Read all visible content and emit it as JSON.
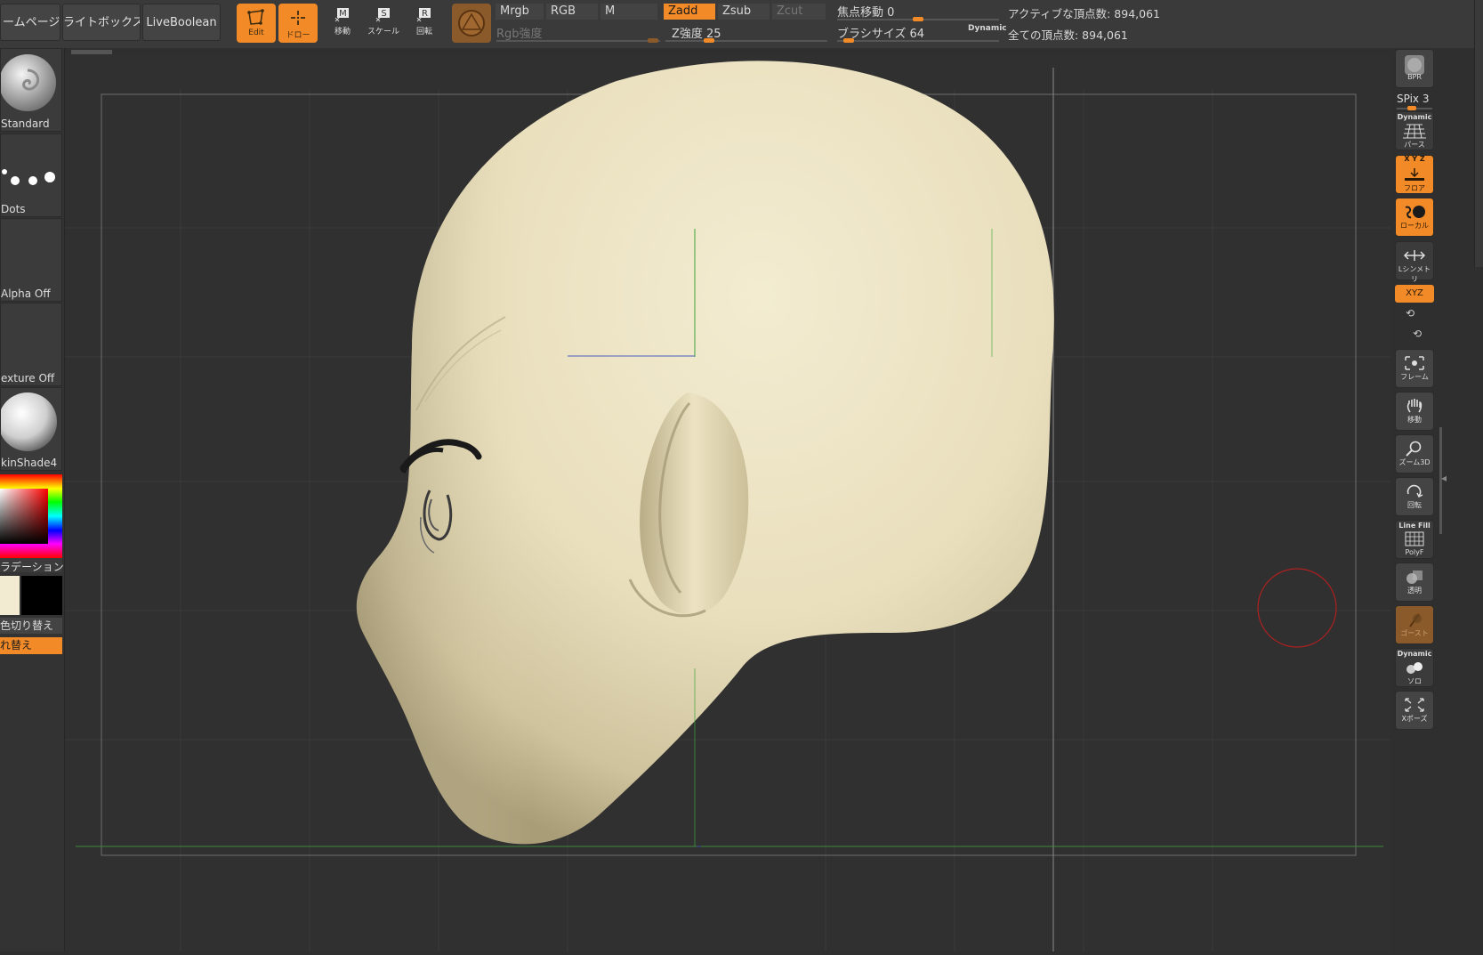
{
  "topbar": {
    "home_page": "ームページ",
    "lightbox": "ライトボックス",
    "liveboolean": "LiveBoolean",
    "edit_label": "Edit",
    "draw_label": "ドロー",
    "move_label": "移動",
    "scale_label": "スケール",
    "rotate_label": "回転",
    "mrgb": "Mrgb",
    "rgb": "RGB",
    "m": "M",
    "rgb_intensity": "Rgb強度",
    "zadd": "Zadd",
    "zsub": "Zsub",
    "zcut": "Zcut",
    "z_intensity_label": "Z強度 25",
    "z_intensity_value": 25,
    "focal_shift_label": "焦点移動 0",
    "focal_shift_value": 0,
    "draw_size_label": "ブラシサイズ 64",
    "draw_size_value": 64,
    "dynamic": "Dynamic",
    "active_points": "アクティブな頂点数: 894,061",
    "total_points": "全ての頂点数: 894,061"
  },
  "leftpanel": {
    "brush": "Standard",
    "stroke": "Dots",
    "alpha": "Alpha Off",
    "texture": "exture Off",
    "material": "kinShade4",
    "gradient": "ラデーション",
    "switch_color": "色切り替え",
    "alternate": "れ替え"
  },
  "rightshelf": {
    "bpr": "BPR",
    "spix": "SPix 3",
    "dynamic_top": "Dynamic",
    "persp": "パース",
    "xyz_top": "X Y Z",
    "floor": "フロア",
    "local": "ローカル",
    "lsym": "Lシンメトリ",
    "xyz_rot": "XYZ",
    "frame": "フレーム",
    "move": "移動",
    "zoom3d": "ズーム3D",
    "rotate": "回転",
    "linefill": "Line Fill",
    "polyf": "PolyF",
    "transp": "透明",
    "ghost": "ゴースト",
    "dynamic_top2": "Dynamic",
    "solo": "ソロ",
    "xpose": "Xポーズ"
  },
  "colors": {
    "accent": "#f28a27",
    "model": "#eee5c8"
  }
}
